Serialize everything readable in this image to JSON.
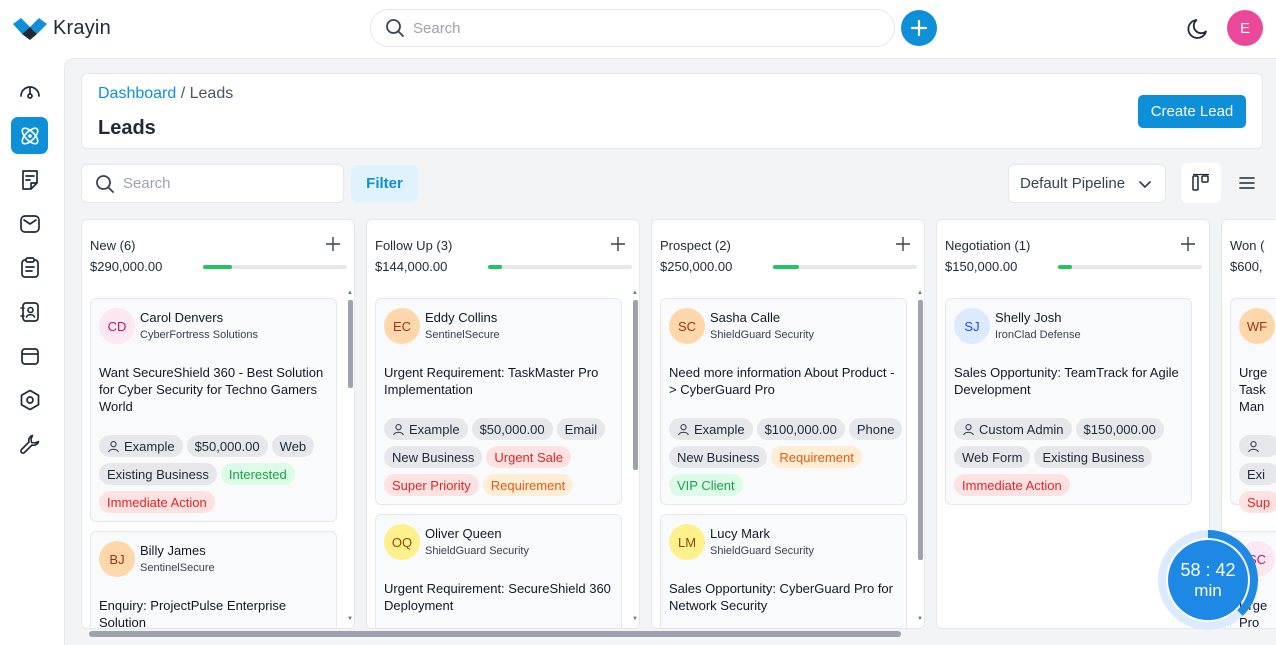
{
  "app": {
    "name": "Krayin"
  },
  "topbar": {
    "search_placeholder": "Search",
    "user_initial": "E"
  },
  "sidebar": {
    "items": [
      {
        "name": "dashboard"
      },
      {
        "name": "leads",
        "active": true
      },
      {
        "name": "quotes"
      },
      {
        "name": "mail"
      },
      {
        "name": "activities"
      },
      {
        "name": "contacts"
      },
      {
        "name": "products"
      },
      {
        "name": "settings"
      },
      {
        "name": "configuration"
      }
    ]
  },
  "header": {
    "breadcrumb_link": "Dashboard",
    "breadcrumb_sep": " / ",
    "breadcrumb_current": "Leads",
    "title": "Leads",
    "create_button": "Create Lead"
  },
  "toolbar": {
    "search_placeholder": "Search",
    "filter_label": "Filter",
    "pipeline_label": "Default Pipeline"
  },
  "columns": [
    {
      "title": "New (6)",
      "amount": "$290,000.00",
      "progress": 0.2,
      "cards": [
        {
          "initials": "CD",
          "avatar_bg": "#fce7f3",
          "avatar_fg": "#be185d",
          "name": "Carol Denvers",
          "org": "CyberFortress Solutions",
          "title": "Want SecureShield 360 - Best Solution for Cyber Security for Techno Gamers World",
          "tags": [
            {
              "text": "Example",
              "kind": "user"
            },
            {
              "text": "$50,000.00",
              "kind": "gray"
            },
            {
              "text": "Web",
              "kind": "gray"
            },
            {
              "text": "Existing Business",
              "kind": "gray"
            },
            {
              "text": "Interested",
              "kind": "green"
            },
            {
              "text": "Immediate Action",
              "kind": "red"
            }
          ]
        },
        {
          "initials": "BJ",
          "avatar_bg": "#fed7aa",
          "avatar_fg": "#9a3412",
          "name": "Billy James",
          "org": "SentinelSecure",
          "title": "Enquiry: ProjectPulse Enterprise Solution",
          "tags": []
        }
      ]
    },
    {
      "title": "Follow Up (3)",
      "amount": "$144,000.00",
      "progress": 0.1,
      "cards": [
        {
          "initials": "EC",
          "avatar_bg": "#fed7aa",
          "avatar_fg": "#9a3412",
          "name": "Eddy Collins",
          "org": "SentinelSecure",
          "title": "Urgent Requirement: TaskMaster Pro Implementation",
          "tags": [
            {
              "text": "Example",
              "kind": "user"
            },
            {
              "text": "$50,000.00",
              "kind": "gray"
            },
            {
              "text": "Email",
              "kind": "gray"
            },
            {
              "text": "New Business",
              "kind": "gray"
            },
            {
              "text": "Urgent Sale",
              "kind": "red"
            },
            {
              "text": "Super Priority",
              "kind": "red"
            },
            {
              "text": "Requirement",
              "kind": "orange"
            }
          ]
        },
        {
          "initials": "OQ",
          "avatar_bg": "#fef08a",
          "avatar_fg": "#854d0e",
          "name": "Oliver Queen",
          "org": "ShieldGuard Security",
          "title": "Urgent Requirement: SecureShield 360 Deployment",
          "tags": []
        }
      ]
    },
    {
      "title": "Prospect (2)",
      "amount": "$250,000.00",
      "progress": 0.18,
      "cards": [
        {
          "initials": "SC",
          "avatar_bg": "#fed7aa",
          "avatar_fg": "#9a3412",
          "name": "Sasha Calle",
          "org": "ShieldGuard Security",
          "title": "Need more information About Product -> CyberGuard Pro",
          "tags": [
            {
              "text": "Example",
              "kind": "user"
            },
            {
              "text": "$100,000.00",
              "kind": "gray"
            },
            {
              "text": "Phone",
              "kind": "gray"
            },
            {
              "text": "New Business",
              "kind": "gray"
            },
            {
              "text": "Requirement",
              "kind": "orange"
            },
            {
              "text": "VIP Client",
              "kind": "green"
            }
          ]
        },
        {
          "initials": "LM",
          "avatar_bg": "#fef08a",
          "avatar_fg": "#854d0e",
          "name": "Lucy Mark",
          "org": "ShieldGuard Security",
          "title": "Sales Opportunity: CyberGuard Pro for Network Security",
          "tags": []
        }
      ]
    },
    {
      "title": "Negotiation (1)",
      "amount": "$150,000.00",
      "progress": 0.1,
      "cards": [
        {
          "initials": "SJ",
          "avatar_bg": "#dbeafe",
          "avatar_fg": "#1d4ed8",
          "name": "Shelly Josh",
          "org": "IronClad Defense",
          "title": "Sales Opportunity: TeamTrack for Agile Development",
          "tags": [
            {
              "text": "Custom Admin",
              "kind": "user"
            },
            {
              "text": "$150,000.00",
              "kind": "gray"
            },
            {
              "text": "Web Form",
              "kind": "gray"
            },
            {
              "text": "Existing Business",
              "kind": "gray"
            },
            {
              "text": "Immediate Action",
              "kind": "red"
            }
          ]
        }
      ]
    },
    {
      "title": "Won (",
      "amount": "$600,",
      "partial": {
        "initials": "WF",
        "title_lines": [
          "Urge",
          "Task",
          "Man"
        ],
        "tag_texts": [
          "",
          "Exi",
          "Sup"
        ],
        "second_initials": "SC",
        "second_title_lines": [
          "Urge",
          "Pro"
        ]
      }
    }
  ],
  "timer": {
    "time": "58 : 42",
    "unit": "min"
  },
  "colors": {
    "accent": "#0e90d9",
    "progress": "#22c55e",
    "timer": "#1e88e5"
  }
}
